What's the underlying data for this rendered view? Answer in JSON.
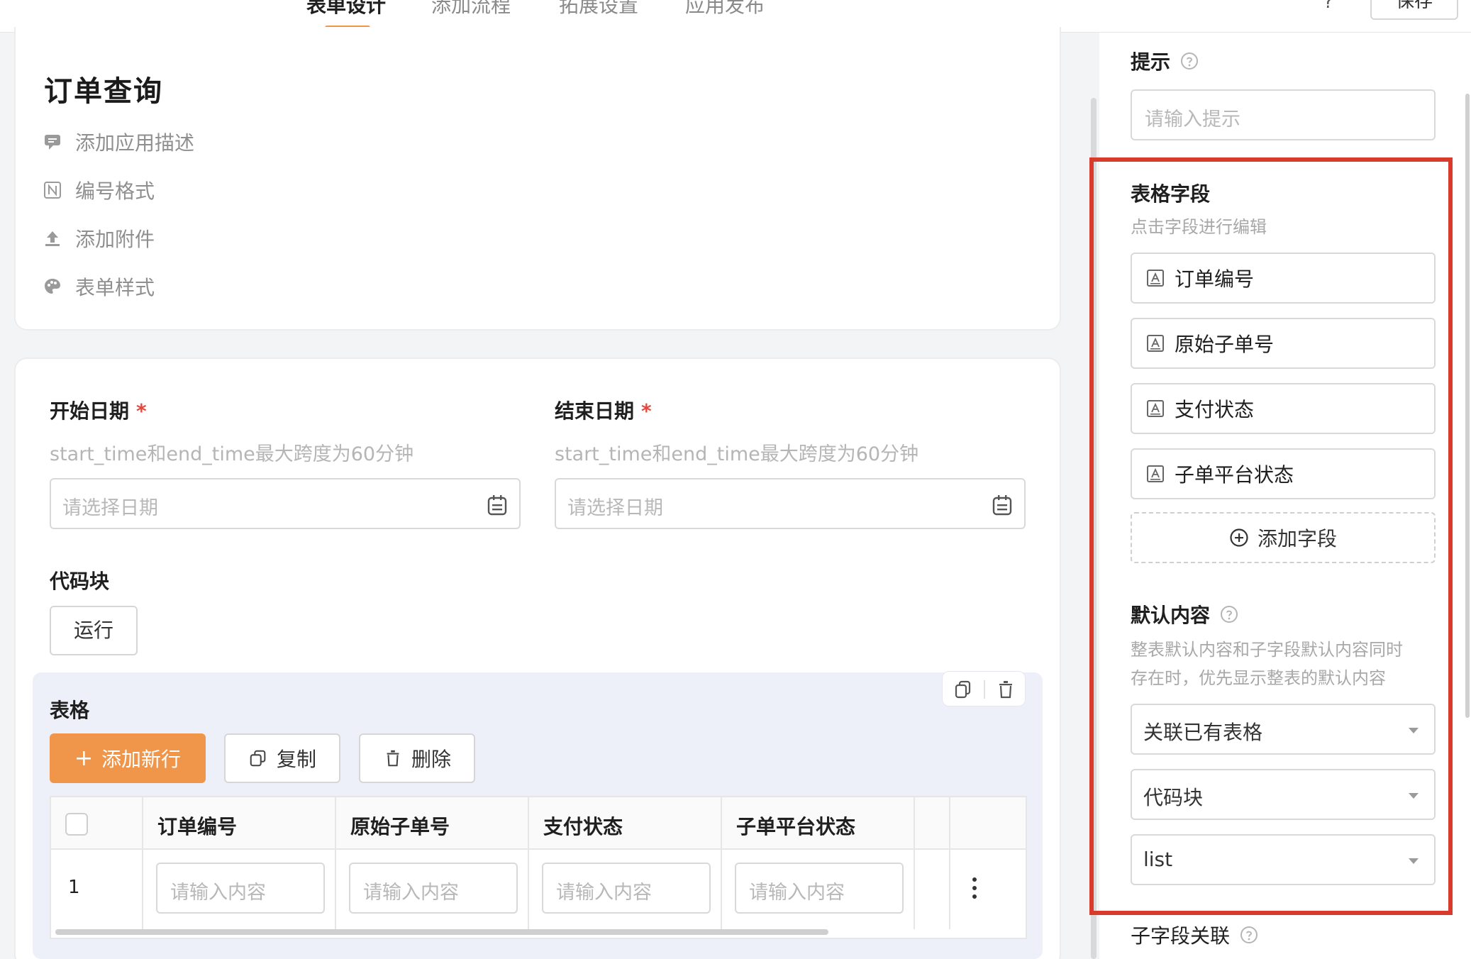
{
  "topbar": {
    "tabs": [
      {
        "label": "表单设计",
        "active": true
      },
      {
        "label": "添加流程",
        "active": false
      },
      {
        "label": "拓展设置",
        "active": false
      },
      {
        "label": "应用发布",
        "active": false
      }
    ],
    "help_glyph": "?",
    "save_label": "保存"
  },
  "app": {
    "title": "订单查询",
    "meta_items": [
      {
        "label": "添加应用描述",
        "icon": "comment-icon"
      },
      {
        "label": "编号格式",
        "icon": "number-format-icon"
      },
      {
        "label": "添加附件",
        "icon": "upload-icon"
      },
      {
        "label": "表单样式",
        "icon": "palette-icon"
      }
    ]
  },
  "form": {
    "start_date": {
      "label": "开始日期",
      "required_mark": "*",
      "hint": "start_time和end_time最大跨度为60分钟",
      "placeholder": "请选择日期"
    },
    "end_date": {
      "label": "结束日期",
      "required_mark": "*",
      "hint": "start_time和end_time最大跨度为60分钟",
      "placeholder": "请选择日期"
    },
    "code_block": {
      "label": "代码块",
      "run_label": "运行"
    },
    "table": {
      "label": "表格",
      "add_row_label": "添加新行",
      "copy_label": "复制",
      "delete_label": "删除",
      "columns": [
        "订单编号",
        "原始子单号",
        "支付状态",
        "子单平台状态"
      ],
      "rows": [
        {
          "index": "1",
          "placeholders": [
            "请输入内容",
            "请输入内容",
            "请输入内容",
            "请输入内容"
          ]
        }
      ]
    }
  },
  "right_panel": {
    "hint_section": {
      "label": "提示",
      "placeholder": "请输入提示"
    },
    "table_fields": {
      "label": "表格字段",
      "sub": "点击字段进行编辑",
      "items": [
        "订单编号",
        "原始子单号",
        "支付状态",
        "子单平台状态"
      ],
      "add_label": "添加字段"
    },
    "default_content": {
      "label": "默认内容",
      "desc_line1": "整表默认内容和子字段默认内容同时",
      "desc_line2": "存在时，优先显示整表的默认内容",
      "selects": [
        "关联已有表格",
        "代码块",
        "list"
      ]
    },
    "sub_field_link": {
      "label": "子字段关联"
    }
  },
  "colors": {
    "accent": "#f0964a",
    "highlight_border": "#d83a2c",
    "required": "#e5483f"
  }
}
